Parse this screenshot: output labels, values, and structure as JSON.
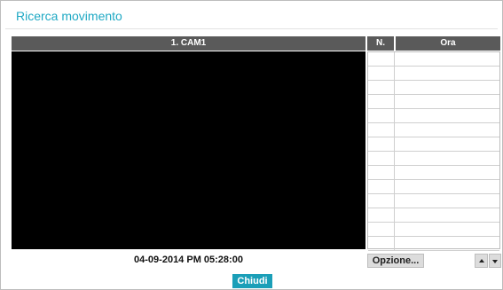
{
  "dialog": {
    "title": "Ricerca movimento"
  },
  "camera": {
    "header": "1. CAM1"
  },
  "playback": {
    "timestamp": "04-09-2014  PM 05:28:00"
  },
  "results_table": {
    "columns": [
      "N.",
      "Ora"
    ],
    "rows": [
      {
        "n": "",
        "ora": ""
      },
      {
        "n": "",
        "ora": ""
      },
      {
        "n": "",
        "ora": ""
      },
      {
        "n": "",
        "ora": ""
      },
      {
        "n": "",
        "ora": ""
      },
      {
        "n": "",
        "ora": ""
      },
      {
        "n": "",
        "ora": ""
      },
      {
        "n": "",
        "ora": ""
      },
      {
        "n": "",
        "ora": ""
      },
      {
        "n": "",
        "ora": ""
      },
      {
        "n": "",
        "ora": ""
      },
      {
        "n": "",
        "ora": ""
      },
      {
        "n": "",
        "ora": ""
      },
      {
        "n": "",
        "ora": ""
      }
    ]
  },
  "buttons": {
    "option_label": "Opzione...",
    "up_icon": "triangle-up-icon",
    "down_icon": "triangle-down-icon",
    "close_label": "Chiudi"
  },
  "colors": {
    "accent": "#1fa9c4",
    "close_button_bg": "#1b9fb8",
    "header_bg": "#5a5a5a",
    "video_bg": "#000000"
  }
}
